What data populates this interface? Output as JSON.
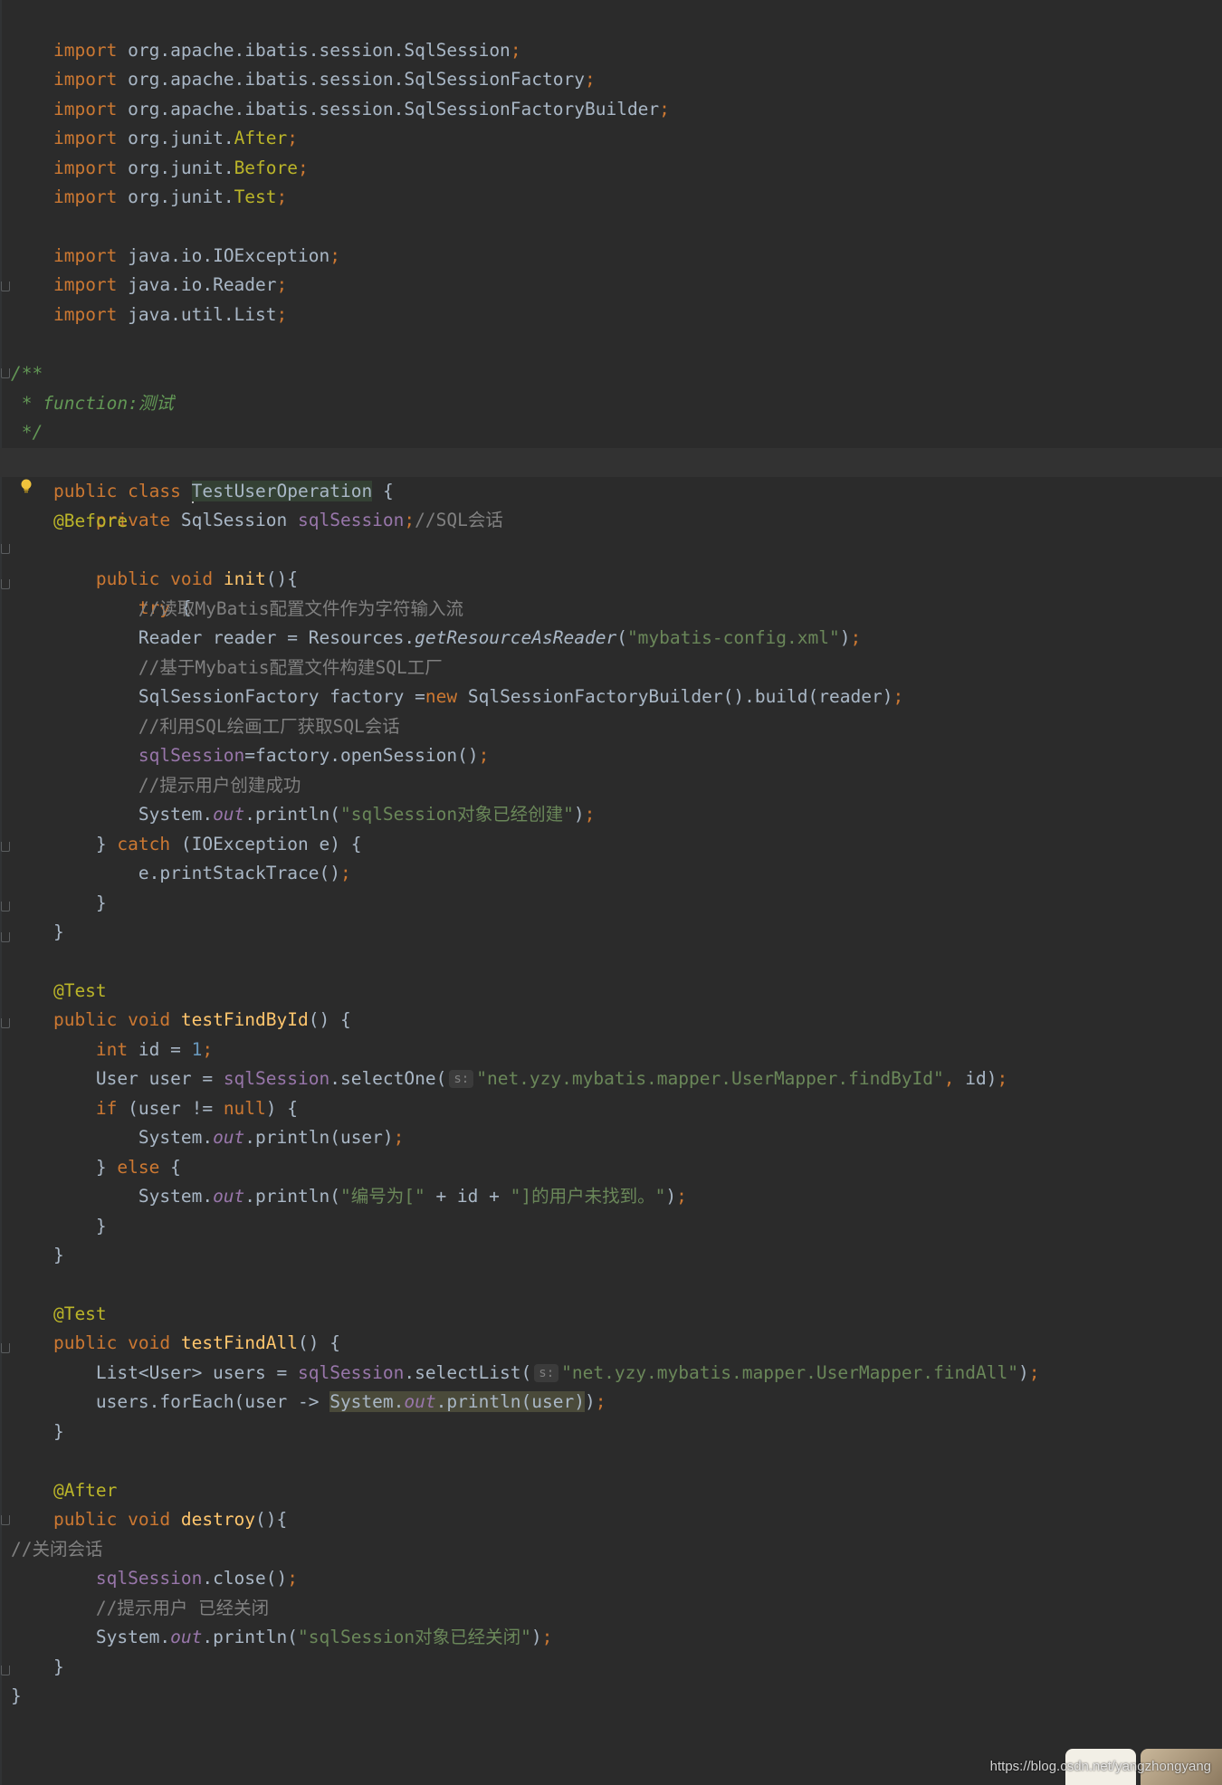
{
  "editor": {
    "code": {
      "l1": "import org.apache.ibatis.session.SqlSession;",
      "l2": "import org.apache.ibatis.session.SqlSessionFactory;",
      "l3": "import org.apache.ibatis.session.SqlSessionFactoryBuilder;",
      "l4": "import org.junit.After;",
      "l5": "import org.junit.Before;",
      "l6": "import org.junit.Test;",
      "l8": "import java.io.IOException;",
      "l9": "import java.io.Reader;",
      "l10": "import java.util.List;",
      "l13": "/**",
      "l14": " * function:测试",
      "l15": " */",
      "l16": "public class TestUserOperation {",
      "l17": "    private SqlSession sqlSession;//SQL会话",
      "l18": "    @Before",
      "l19": "    public void init(){",
      "l20": "        try {",
      "l21": "            //读取MyBatis配置文件作为字符输入流",
      "l22": "            Reader reader = Resources.getResourceAsReader(\"mybatis-config.xml\");",
      "l23": "            //基于Mybatis配置文件构建SQL工厂",
      "l24": "            SqlSessionFactory factory =new SqlSessionFactoryBuilder().build(reader);",
      "l25": "            //利用SQL绘画工厂获取SQL会话",
      "l26": "            sqlSession=factory.openSession();",
      "l27": "            //提示用户创建成功",
      "l28": "            System.out.println(\"sqlSession对象已经创建\");",
      "l29": "        } catch (IOException e) {",
      "l30": "            e.printStackTrace();",
      "l31": "        }",
      "l32": "    }",
      "l34": "    @Test",
      "l35": "    public void testFindById() {",
      "l36": "        int id = 1;",
      "l37": "        User user = sqlSession.selectOne( s: \"net.yzy.mybatis.mapper.UserMapper.findById\", id);",
      "l38": "        if (user != null) {",
      "l39": "            System.out.println(user);",
      "l40": "        } else {",
      "l41": "            System.out.println(\"编号为[\" + id + \"]的用户未找到。\");",
      "l42": "        }",
      "l43": "    }",
      "l45": "    @Test",
      "l46": "    public void testFindAll() {",
      "l47": "        List<User> users = sqlSession.selectList( s: \"net.yzy.mybatis.mapper.UserMapper.findAll\");",
      "l48": "        users.forEach(user -> System.out.println(user));",
      "l49": "    }",
      "l51": "    @After",
      "l52": "    public void destroy(){",
      "l53": "//关闭会话",
      "l54": "        sqlSession.close();",
      "l55": "        //提示用户 已经关闭",
      "l56": "        System.out.println(\"sqlSession对象已经关闭\");",
      "l57": "    }",
      "l58": "}"
    },
    "inlay_hint": "s:"
  },
  "watermark": "https://blog.csdn.net/yangzhongyang",
  "colors": {
    "background": "#2b2b2b",
    "keyword": "#cc7832",
    "string": "#6a8759",
    "comment": "#808080",
    "field": "#9876aa",
    "annotation": "#bbb529",
    "method": "#ffc66d",
    "number": "#6897bb"
  }
}
